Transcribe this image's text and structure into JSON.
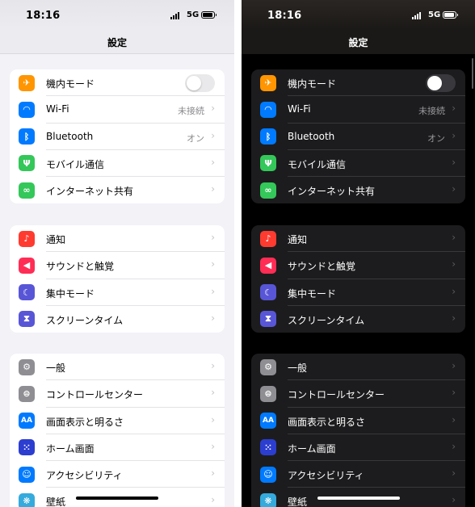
{
  "status": {
    "time": "18:16",
    "network": "5G"
  },
  "nav": {
    "title": "設定"
  },
  "groups": [
    [
      {
        "key": "airplane",
        "label": "機内モード",
        "icon": "airplane-icon",
        "color": "#ff9500",
        "glyph": "✈",
        "toggle": true
      },
      {
        "key": "wifi",
        "label": "Wi-Fi",
        "value": "未接続",
        "icon": "wifi-icon",
        "color": "#007aff",
        "glyph": "◠"
      },
      {
        "key": "bluetooth",
        "label": "Bluetooth",
        "value": "オン",
        "icon": "bluetooth-icon",
        "color": "#007aff",
        "glyph": "ᛒ"
      },
      {
        "key": "mobile",
        "label": "モバイル通信",
        "icon": "antenna-icon",
        "color": "#34c759",
        "glyph": "Ψ"
      },
      {
        "key": "hotspot",
        "label": "インターネット共有",
        "icon": "link-icon",
        "color": "#34c759",
        "glyph": "∞"
      }
    ],
    [
      {
        "key": "notifications",
        "label": "通知",
        "icon": "bell-icon",
        "color": "#ff3b30",
        "glyph": "♪"
      },
      {
        "key": "sounds",
        "label": "サウンドと触覚",
        "icon": "speaker-icon",
        "color": "#ff2d55",
        "glyph": "◀"
      },
      {
        "key": "focus",
        "label": "集中モード",
        "icon": "moon-icon",
        "color": "#5856d6",
        "glyph": "☾"
      },
      {
        "key": "screentime",
        "label": "スクリーンタイム",
        "icon": "hourglass-icon",
        "color": "#5856d6",
        "glyph": "⧗"
      }
    ],
    [
      {
        "key": "general",
        "label": "一般",
        "icon": "gear-icon",
        "color": "#8e8e93",
        "glyph": "⚙"
      },
      {
        "key": "control",
        "label": "コントロールセンター",
        "icon": "switches-icon",
        "color": "#8e8e93",
        "glyph": "⊜"
      },
      {
        "key": "display",
        "label": "画面表示と明るさ",
        "icon": "text-size-icon",
        "color": "#007aff",
        "glyph": "AA"
      },
      {
        "key": "home",
        "label": "ホーム画面",
        "icon": "home-grid-icon",
        "color": "#2c3ed0",
        "glyph": "⁙"
      },
      {
        "key": "accessibility",
        "label": "アクセシビリティ",
        "icon": "accessibility-icon",
        "color": "#007aff",
        "glyph": "☺"
      },
      {
        "key": "wallpaper",
        "label": "壁紙",
        "icon": "flower-icon",
        "color": "#35aadc",
        "glyph": "❋"
      }
    ]
  ]
}
